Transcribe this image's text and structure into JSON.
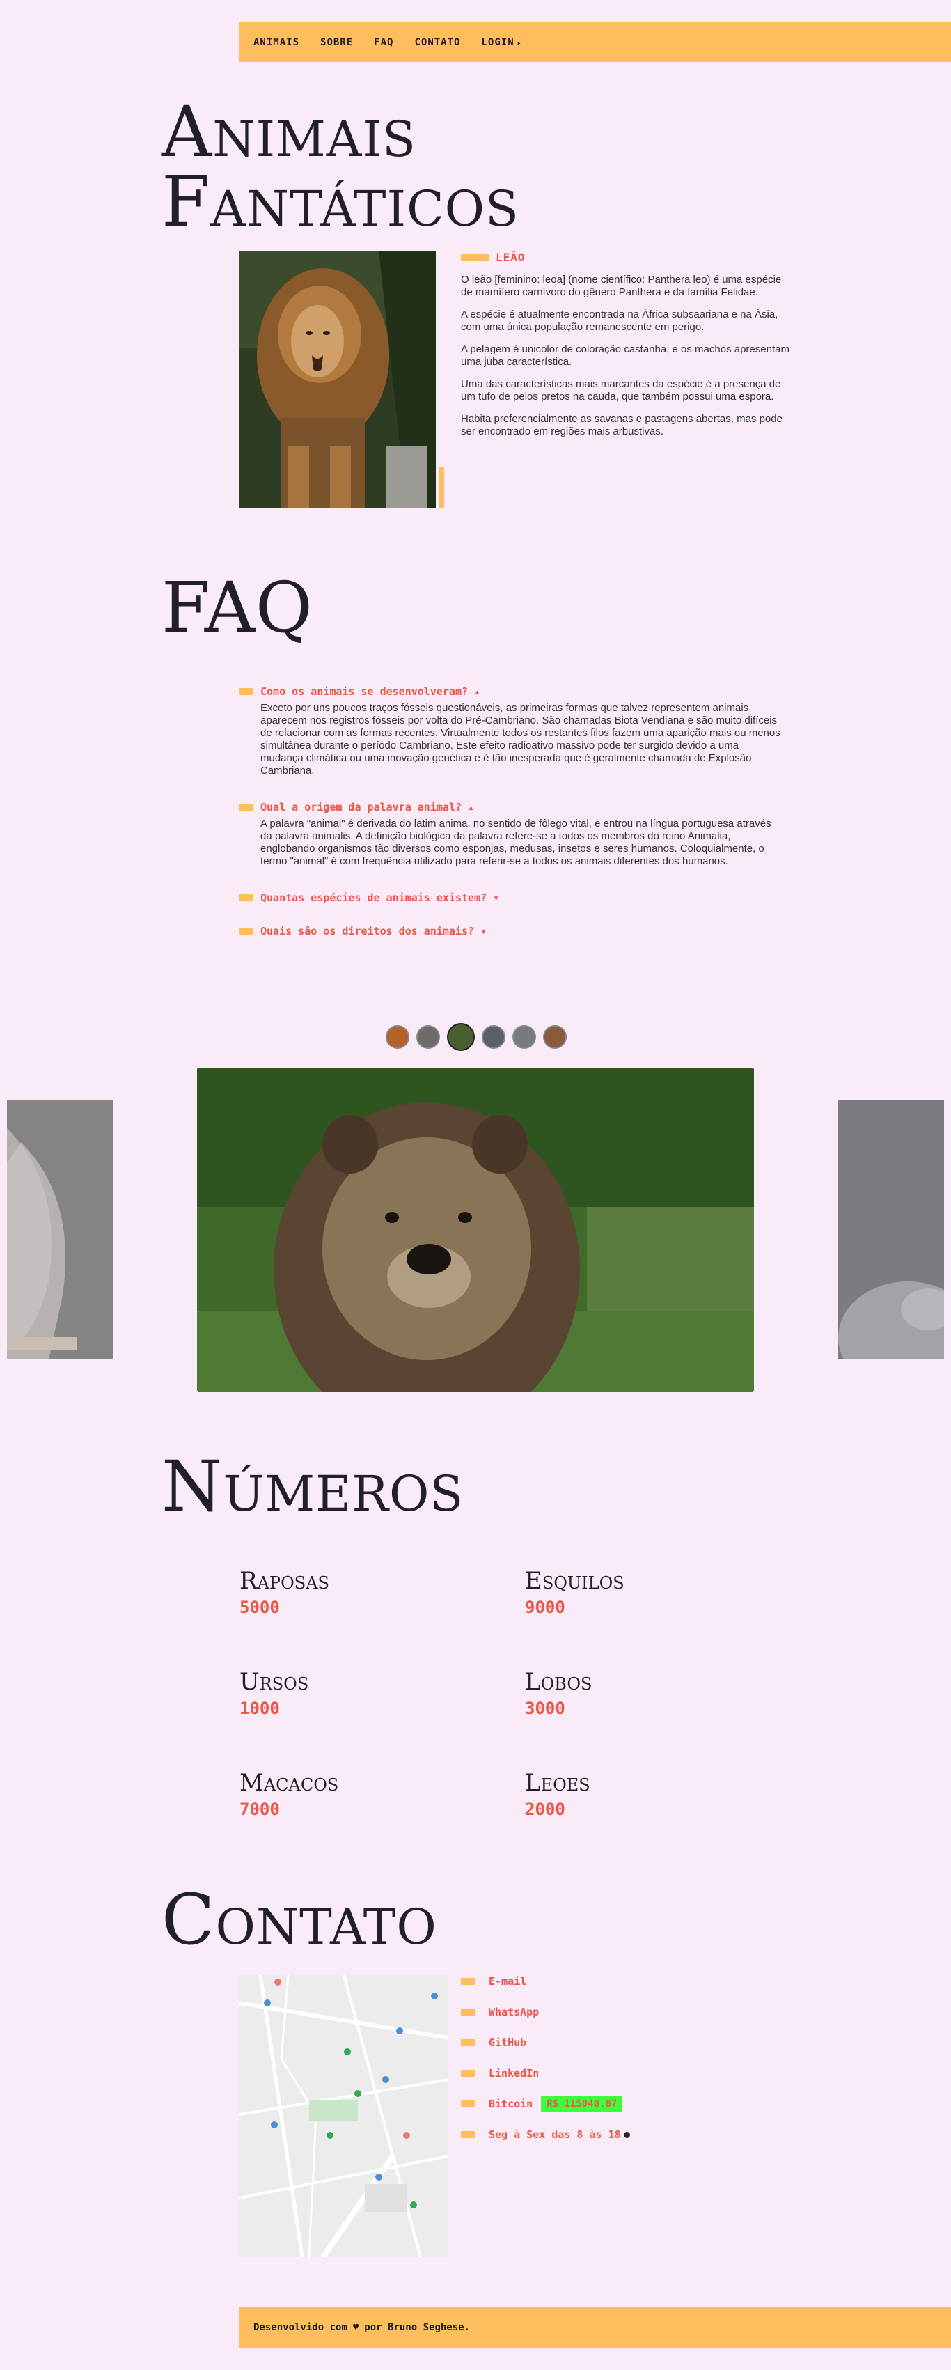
{
  "nav": {
    "items": [
      "ANIMAIS",
      "SOBRE",
      "FAQ",
      "CONTATO",
      "LOGIN"
    ],
    "login_arrow": "▸"
  },
  "animais": {
    "title_line1": "Animais",
    "title_line2": "Fantáticos",
    "current_animal": "LEÃO",
    "paragraphs": [
      "O leão [feminino: leoa] (nome científico: Panthera leo) é uma espécie de mamífero carnívoro do gênero Panthera e da família Felidae.",
      "A espécie é atualmente encontrada na África subsaariana e na Ásia, com uma única população remanescente em perigo.",
      "A pelagem é unicolor de coloração castanha, e os machos apresentam uma juba característica.",
      "Uma das características mais marcantes da espécie é a presença de um tufo de pelos pretos na cauda, que também possui uma espora.",
      "Habita preferencialmente as savanas e pastagens abertas, mas pode ser encontrado em regiões mais arbustivas."
    ]
  },
  "faq": {
    "title": "FAQ",
    "items": [
      {
        "q": "Como os animais se desenvolveram? ▴",
        "a": "Exceto por uns poucos traços fósseis questionáveis, as primeiras formas que talvez representem animais aparecem nos registros fósseis por volta do Pré-Cambriano. São chamadas Biota Vendiana e são muito difíceis de relacionar com as formas recentes. Virtualmente todos os restantes filos fazem uma aparição mais ou menos simultânea durante o período Cambriano. Este efeito radioativo massivo pode ter surgido devido a uma mudança climática ou uma inovação genética e é tão inesperada que é geralmente chamada de Explosão Cambriana."
      },
      {
        "q": "Qual a origem da palavra animal? ▴",
        "a": "A palavra \"animal\" é derivada do latim anima, no sentido de fôlego vital, e entrou na língua portuguesa através da palavra animalis. A definição biológica da palavra refere-se a todos os membros do reino Animalia, englobando organismos tão diversos como esponjas, medusas, insetos e seres humanos. Coloquialmente, o termo \"animal\" é com frequência utilizado para referir-se a todos os animais diferentes dos humanos."
      },
      {
        "q": "Quantas espécies de animais existem? ▾",
        "a": ""
      },
      {
        "q": "Quais são os direitos dos animais? ▾",
        "a": ""
      }
    ]
  },
  "numeros": {
    "title": "Números",
    "items": [
      {
        "name": "Raposas",
        "value": "5000"
      },
      {
        "name": "Esquilos",
        "value": "9000"
      },
      {
        "name": "Ursos",
        "value": "1000"
      },
      {
        "name": "Lobos",
        "value": "3000"
      },
      {
        "name": "Macacos",
        "value": "7000"
      },
      {
        "name": "Leoes",
        "value": "2000"
      }
    ]
  },
  "contato": {
    "title": "Contato",
    "items": [
      "E-mail",
      "WhatsApp",
      "GitHub",
      "LinkedIn",
      "Bitcoin",
      "Seg à Sex das 8 às 18"
    ],
    "bitcoin_value": "R$ 115040,87"
  },
  "footer": {
    "prefix": "Desenvolvido com",
    "suffix": "por Bruno Seghese."
  },
  "colors": {
    "background": "#faebf8",
    "accent": "#febe5e",
    "highlight": "#ee5544",
    "bitcoin_badge": "#3dff3d"
  }
}
